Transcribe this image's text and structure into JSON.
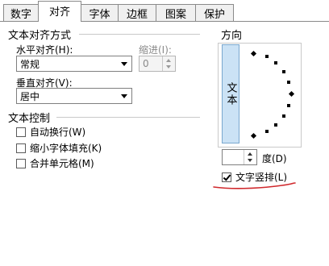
{
  "tabs": [
    {
      "label": "数字",
      "active": false
    },
    {
      "label": "对齐",
      "active": true
    },
    {
      "label": "字体",
      "active": false
    },
    {
      "label": "边框",
      "active": false
    },
    {
      "label": "图案",
      "active": false
    },
    {
      "label": "保护",
      "active": false
    }
  ],
  "text_alignment": {
    "section_title": "文本对齐方式",
    "horizontal_label": "水平对齐(H):",
    "horizontal_value": "常规",
    "indent_label": "缩进(I):",
    "indent_value": "0",
    "vertical_label": "垂直对齐(V):",
    "vertical_value": "居中"
  },
  "text_control": {
    "section_title": "文本控制",
    "wrap_label": "自动换行(W)",
    "wrap_checked": false,
    "shrink_label": "缩小字体填充(K)",
    "shrink_checked": false,
    "merge_label": "合并单元格(M)",
    "merge_checked": false
  },
  "orientation": {
    "section_title": "方向",
    "vertical_text_button": "文本",
    "degree_value": "",
    "degree_label": "度(D)",
    "vertical_text_label": "文字竖排(L)",
    "vertical_text_checked": true
  },
  "colors": {
    "annotation_red": "#d0282c",
    "button_blue": "#cbe2f5"
  }
}
